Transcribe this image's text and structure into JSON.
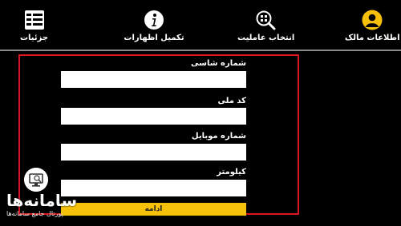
{
  "steps": [
    {
      "label": "جزئیات",
      "icon": "details-icon"
    },
    {
      "label": "تکمیل اظهارات",
      "icon": "info-icon"
    },
    {
      "label": "انتخاب عاملیت",
      "icon": "search-grid-icon"
    },
    {
      "label": "اطلاعات مالک",
      "icon": "user-icon"
    }
  ],
  "form": {
    "chassis_label": "شماره شاسی",
    "chassis_value": "",
    "national_code_label": "کد ملی",
    "national_code_value": "",
    "mobile_label": "شماره موبایل",
    "mobile_value": "",
    "mileage_label": "کیلومتر",
    "mileage_value": "",
    "continue_label": "ادامه"
  },
  "colors": {
    "accent": "#f6c10a",
    "highlight_border": "#d9161e"
  },
  "watermark": {
    "title": "سامانه‌ها",
    "subtitle": "پورتال جامع سامانه‌ها"
  }
}
